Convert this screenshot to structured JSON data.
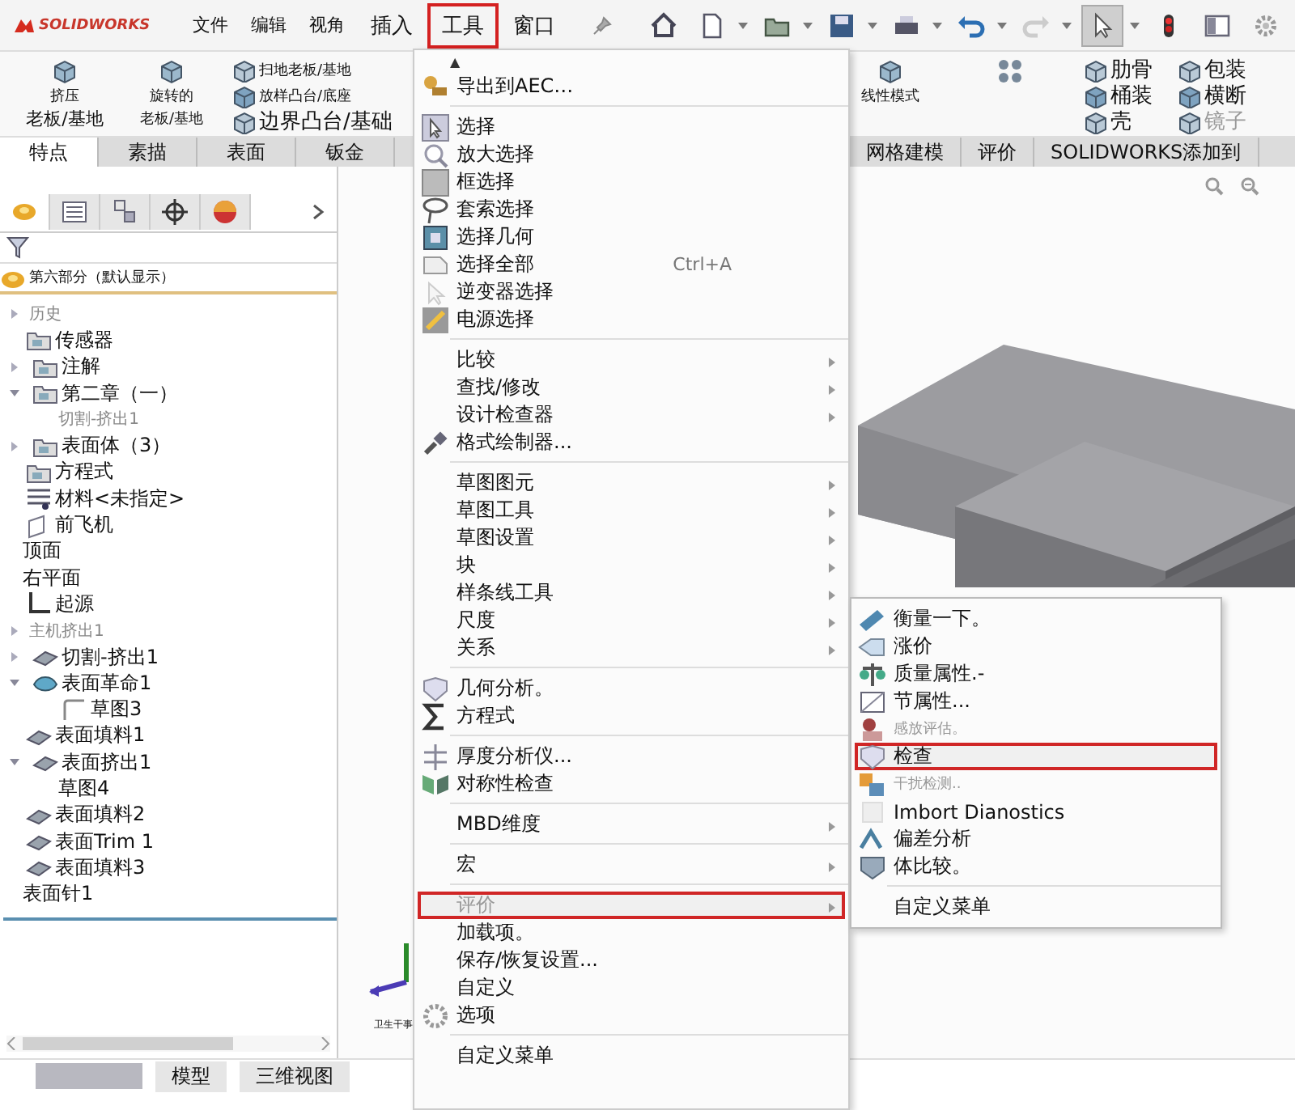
{
  "app_bar": {
    "logo": "SOLIDWORKS",
    "menus": [
      {
        "label": "文件",
        "selected": false
      },
      {
        "label": "编辑",
        "selected": false
      },
      {
        "label": "视角",
        "selected": false
      },
      {
        "label": "插入",
        "selected": false
      },
      {
        "label": "工具",
        "selected": true
      },
      {
        "label": "窗口",
        "selected": false
      }
    ]
  },
  "ribbon": {
    "left_commands": [
      {
        "kind": "big",
        "lines": [
          "挤压",
          "老板/基地"
        ]
      },
      {
        "kind": "big",
        "lines": [
          "旋转的",
          "老板/基地"
        ]
      },
      {
        "kind": "stack",
        "items": [
          "扫地老板/基地",
          "放样凸台/底座",
          "边界凸台/基础"
        ]
      }
    ],
    "right_commands": [
      {
        "kind": "big",
        "lines": [
          "线性模式"
        ]
      },
      {
        "kind": "icon-only"
      },
      {
        "kind": "stack",
        "items": [
          "肋骨",
          "桶装",
          "壳"
        ]
      },
      {
        "kind": "stack",
        "items": [
          "包装",
          "横断",
          "镜子"
        ]
      }
    ]
  },
  "ribbon_tabs": {
    "left": [
      {
        "label": "特点",
        "selected": true
      },
      {
        "label": "素描",
        "selected": false
      },
      {
        "label": "表面",
        "selected": false
      },
      {
        "label": "钣金",
        "selected": false
      }
    ],
    "right": [
      {
        "label": "网格建模",
        "selected": false
      },
      {
        "label": "评价",
        "selected": false
      },
      {
        "label": "SOLIDWORKS添加到",
        "selected": false
      }
    ]
  },
  "feature_tree": {
    "panel_tabs": [
      {
        "selected": true
      },
      {
        "selected": false
      },
      {
        "selected": false
      },
      {
        "selected": false
      },
      {
        "selected": false
      }
    ],
    "root": "第六部分（默认显示）",
    "items": [
      {
        "label": "历史",
        "kind": "plain",
        "expandable": true,
        "expanded": false,
        "disabled": true
      },
      {
        "label": "传感器",
        "kind": "folder",
        "expandable": false,
        "disabled": false
      },
      {
        "label": "注解",
        "kind": "folder",
        "expandable": true,
        "expanded": false,
        "disabled": false
      },
      {
        "label": "第二章（一）",
        "kind": "folder",
        "expandable": true,
        "expanded": true,
        "disabled": false,
        "children": [
          {
            "label": "切割-挤出1",
            "kind": "plain",
            "expandable": false,
            "disabled": true
          }
        ]
      },
      {
        "label": "表面体（3）",
        "kind": "folder",
        "expandable": true,
        "expanded": false,
        "disabled": false
      },
      {
        "label": "方程式",
        "kind": "folder",
        "expandable": false,
        "disabled": false
      },
      {
        "label": "材料<未指定>",
        "kind": "material",
        "expandable": false,
        "disabled": false
      },
      {
        "label": "前飞机",
        "kind": "plane",
        "expandable": false,
        "disabled": false
      },
      {
        "label": "顶面",
        "kind": "plain",
        "expandable": false,
        "disabled": false
      },
      {
        "label": "右平面",
        "kind": "plain",
        "expandable": false,
        "disabled": false
      },
      {
        "label": "起源",
        "kind": "origin",
        "expandable": false,
        "disabled": false
      },
      {
        "label": "主机挤出1",
        "kind": "plain",
        "expandable": true,
        "expanded": false,
        "disabled": true
      },
      {
        "label": "切割-挤出1",
        "kind": "surface",
        "expandable": true,
        "expanded": false,
        "disabled": false
      },
      {
        "label": "表面革命1",
        "kind": "revolve",
        "expandable": true,
        "expanded": true,
        "disabled": false,
        "children": [
          {
            "label": "草图3",
            "kind": "sketch",
            "expandable": false,
            "disabled": false
          }
        ]
      },
      {
        "label": "表面填料1",
        "kind": "surface",
        "expandable": false,
        "disabled": false
      },
      {
        "label": "表面挤出1",
        "kind": "surface",
        "expandable": true,
        "expanded": true,
        "disabled": false,
        "children": [
          {
            "label": "草图4",
            "kind": "plain",
            "expandable": false,
            "disabled": false
          }
        ]
      },
      {
        "label": "表面填料2",
        "kind": "surface",
        "expandable": false,
        "disabled": false
      },
      {
        "label": "表面Trim 1",
        "kind": "surface",
        "expandable": false,
        "disabled": false
      },
      {
        "label": "表面填料3",
        "kind": "surface",
        "expandable": false,
        "disabled": false
      },
      {
        "label": "表面针1",
        "kind": "plain",
        "expandable": false,
        "disabled": false
      }
    ]
  },
  "bottom_tabs": [
    {
      "label": "模型",
      "selected": false
    },
    {
      "label": "三维视图",
      "selected": false
    }
  ],
  "viewport": {
    "caption": "卫生干事"
  },
  "tools_menu": {
    "scroll_up": "▲",
    "sections": [
      [
        {
          "label": "导出到AEC…",
          "icon": true,
          "submenu": false,
          "selected": false,
          "disabled": false
        }
      ],
      [
        {
          "label": "选择",
          "icon": true,
          "submenu": false,
          "selected": false,
          "disabled": false
        },
        {
          "label": "放大选择",
          "icon": true,
          "submenu": false,
          "selected": false,
          "disabled": false
        },
        {
          "label": "框选择",
          "icon": true,
          "submenu": false,
          "selected": false,
          "disabled": false
        },
        {
          "label": "套索选择",
          "icon": true,
          "submenu": false,
          "selected": false,
          "disabled": false
        },
        {
          "label": "选择几何",
          "icon": true,
          "submenu": false,
          "selected": false,
          "disabled": false
        },
        {
          "label": "选择全部",
          "icon": true,
          "submenu": false,
          "selected": false,
          "disabled": false,
          "shortcut": "Ctrl+A"
        },
        {
          "label": "逆变器选择",
          "icon": true,
          "submenu": false,
          "selected": false,
          "disabled": false
        },
        {
          "label": "电源选择",
          "icon": true,
          "submenu": false,
          "selected": false,
          "disabled": false
        }
      ],
      [
        {
          "label": "比较",
          "icon": false,
          "submenu": true,
          "selected": false,
          "disabled": false
        },
        {
          "label": "查找/修改",
          "icon": false,
          "submenu": true,
          "selected": false,
          "disabled": false
        },
        {
          "label": "设计检查器",
          "icon": false,
          "submenu": true,
          "selected": false,
          "disabled": false
        },
        {
          "label": "格式绘制器...",
          "icon": true,
          "submenu": false,
          "selected": false,
          "disabled": false
        }
      ],
      [
        {
          "label": "草图图元",
          "icon": false,
          "submenu": true,
          "selected": false,
          "disabled": false
        },
        {
          "label": "草图工具",
          "icon": false,
          "submenu": true,
          "selected": false,
          "disabled": false
        },
        {
          "label": "草图设置",
          "icon": false,
          "submenu": true,
          "selected": false,
          "disabled": false
        },
        {
          "label": "块",
          "icon": false,
          "submenu": true,
          "selected": false,
          "disabled": false
        },
        {
          "label": "样条线工具",
          "icon": false,
          "submenu": true,
          "selected": false,
          "disabled": false
        },
        {
          "label": "尺度",
          "icon": false,
          "submenu": true,
          "selected": false,
          "disabled": false
        },
        {
          "label": "关系",
          "icon": false,
          "submenu": true,
          "selected": false,
          "disabled": false
        }
      ],
      [
        {
          "label": "几何分析。",
          "icon": true,
          "submenu": false,
          "selected": false,
          "disabled": false
        },
        {
          "label": "方程式",
          "icon": true,
          "submenu": false,
          "selected": false,
          "disabled": false
        }
      ],
      [
        {
          "label": "厚度分析仪...",
          "icon": true,
          "submenu": false,
          "selected": false,
          "disabled": false
        },
        {
          "label": "对称性检查",
          "icon": true,
          "submenu": false,
          "selected": false,
          "disabled": false
        }
      ],
      [
        {
          "label": "MBD维度",
          "icon": false,
          "submenu": true,
          "selected": false,
          "disabled": false
        }
      ],
      [
        {
          "label": "宏",
          "icon": false,
          "submenu": true,
          "selected": false,
          "disabled": false
        }
      ],
      [
        {
          "label": "评价",
          "icon": false,
          "submenu": true,
          "selected": true,
          "disabled": true
        },
        {
          "label": "加载项。",
          "icon": false,
          "submenu": false,
          "selected": false,
          "disabled": false
        },
        {
          "label": "保存/恢复设置...",
          "icon": false,
          "submenu": false,
          "selected": false,
          "disabled": false
        },
        {
          "label": "自定义",
          "icon": false,
          "submenu": false,
          "selected": false,
          "disabled": false
        },
        {
          "label": "选项",
          "icon": true,
          "submenu": false,
          "selected": false,
          "disabled": false
        }
      ],
      [
        {
          "label": "自定义菜单",
          "icon": false,
          "submenu": false,
          "selected": false,
          "disabled": false
        }
      ]
    ]
  },
  "evaluate_submenu": {
    "sections": [
      [
        {
          "label": "衡量一下。",
          "icon": true,
          "selected": false,
          "disabled": false
        },
        {
          "label": "涨价",
          "icon": true,
          "selected": false,
          "disabled": false
        },
        {
          "label": "质量属性.-",
          "icon": true,
          "selected": false,
          "disabled": false
        },
        {
          "label": "节属性...",
          "icon": true,
          "selected": false,
          "disabled": false
        },
        {
          "label": "感放评估。",
          "icon": true,
          "selected": false,
          "disabled": true
        },
        {
          "label": "检查",
          "icon": true,
          "selected": true,
          "disabled": false
        },
        {
          "label": "干扰检测..",
          "icon": true,
          "selected": false,
          "disabled": true
        },
        {
          "label": "Imbort Dianostics",
          "icon": true,
          "selected": false,
          "disabled": false
        },
        {
          "label": "偏差分析",
          "icon": true,
          "selected": false,
          "disabled": false
        },
        {
          "label": "体比较。",
          "icon": true,
          "selected": false,
          "disabled": false
        }
      ],
      [
        {
          "label": "自定义菜单",
          "icon": false,
          "selected": false,
          "disabled": false
        }
      ]
    ]
  }
}
